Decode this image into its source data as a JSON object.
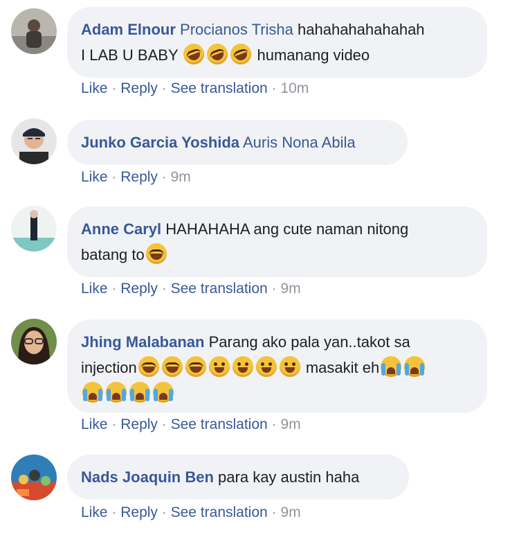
{
  "comments": [
    {
      "author": "Adam Elnour",
      "tag": "Procianos Trisha",
      "text_part1": "hahahahahahahah",
      "text_part2": "I LAB U BABY",
      "text_part3": "humanang video",
      "actions": {
        "like": "Like",
        "reply": "Reply",
        "translate": "See translation",
        "time": "10m"
      },
      "avatar_icon": "man-portrait-icon"
    },
    {
      "author": "Junko Garcia Yoshida",
      "tag": "Auris Nona Abila",
      "actions": {
        "like": "Like",
        "reply": "Reply",
        "time": "9m"
      },
      "avatar_icon": "man-with-cap-icon"
    },
    {
      "author": "Anne Caryl",
      "text_part1": "HAHAHAHA ang cute naman nitong",
      "text_part2": "batang to",
      "actions": {
        "like": "Like",
        "reply": "Reply",
        "translate": "See translation",
        "time": "9m"
      },
      "avatar_icon": "person-outdoor-icon"
    },
    {
      "author": "Jhing Malabanan",
      "text_part1": "Parang ako pala yan..takot sa",
      "text_part2": "injection",
      "text_part3": "masakit eh",
      "actions": {
        "like": "Like",
        "reply": "Reply",
        "translate": "See translation",
        "time": "9m"
      },
      "avatar_icon": "woman-glasses-icon"
    },
    {
      "author": "Nads Joaquin Ben",
      "text_part1": "para kay austin haha",
      "actions": {
        "like": "Like",
        "reply": "Reply",
        "translate": "See translation",
        "time": "9m"
      },
      "avatar_icon": "colorful-group-icon"
    }
  ],
  "separator": "·",
  "colors": {
    "link": "#385898",
    "muted": "#90949c",
    "bubble": "#f0f2f5",
    "text": "#1c1e21"
  }
}
